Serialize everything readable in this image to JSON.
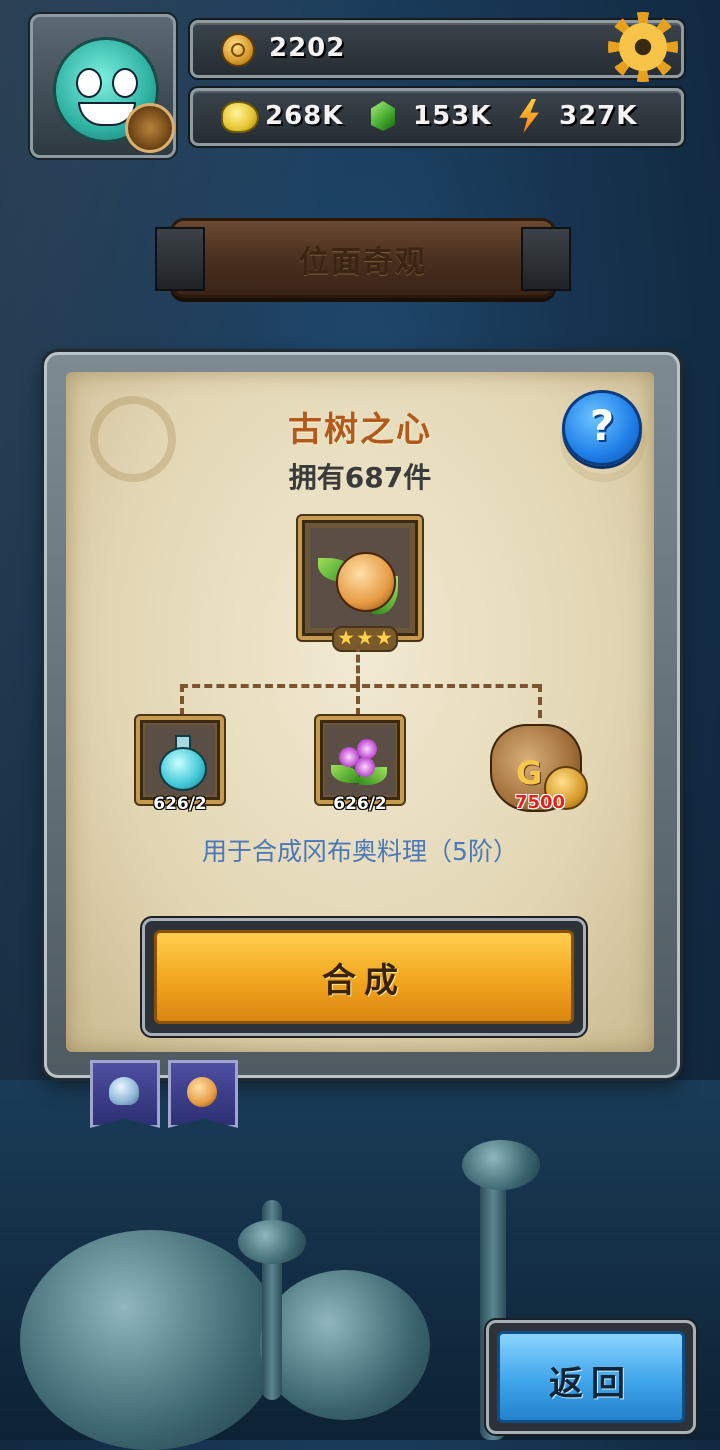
{
  "hud": {
    "coins": "2202",
    "gold": "268K",
    "crystals": "153K",
    "energy": "327K"
  },
  "banner": {
    "title": "位面奇观"
  },
  "item": {
    "name": "古树之心",
    "owned": "拥有687件",
    "stars": 3
  },
  "recipe": {
    "ingredients": [
      {
        "icon": "potion-icon",
        "qty": "626/2"
      },
      {
        "icon": "flower-icon",
        "qty": "626/2"
      }
    ],
    "gold_cost": "7500",
    "usage": "用于合成冈布奥料理（5阶）"
  },
  "buttons": {
    "craft": "合成",
    "back": "返回",
    "help": "?"
  },
  "tabs": [
    {
      "icon": "helmet-icon"
    },
    {
      "icon": "heart-fruit-icon"
    }
  ]
}
